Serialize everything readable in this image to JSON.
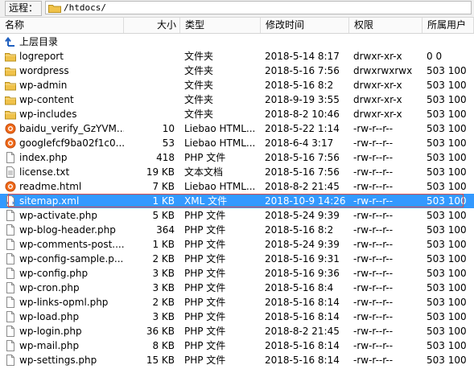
{
  "path_bar": {
    "label": "远程：",
    "path": "/htdocs/"
  },
  "columns": {
    "name": "名称",
    "size": "大小",
    "type": "类型",
    "modified": "修改时间",
    "permissions": "权限",
    "owner": "所属用户"
  },
  "parent_dir": {
    "label": "上层目录"
  },
  "files": [
    {
      "name": "logreport",
      "size": "",
      "type": "文件夹",
      "modified": "2018-5-14 8:17",
      "permissions": "drwxr-xr-x",
      "owner": "0 0",
      "icon": "folder-icon"
    },
    {
      "name": "wordpress",
      "size": "",
      "type": "文件夹",
      "modified": "2018-5-16 7:56",
      "permissions": "drwxrwxrwx",
      "owner": "503 100",
      "icon": "folder-icon"
    },
    {
      "name": "wp-admin",
      "size": "",
      "type": "文件夹",
      "modified": "2018-5-16 8:2",
      "permissions": "drwxr-xr-x",
      "owner": "503 100",
      "icon": "folder-icon"
    },
    {
      "name": "wp-content",
      "size": "",
      "type": "文件夹",
      "modified": "2018-9-19 3:55",
      "permissions": "drwxr-xr-x",
      "owner": "503 100",
      "icon": "folder-icon"
    },
    {
      "name": "wp-includes",
      "size": "",
      "type": "文件夹",
      "modified": "2018-8-2 10:46",
      "permissions": "drwxr-xr-x",
      "owner": "503 100",
      "icon": "folder-icon"
    },
    {
      "name": "baidu_verify_GzYVM...",
      "size": "10",
      "type": "Liebao HTML...",
      "modified": "2018-5-22 1:14",
      "permissions": "-rw-r--r--",
      "owner": "503 100",
      "icon": "browser-html-icon"
    },
    {
      "name": "googlefcf9ba02f1c0...",
      "size": "53",
      "type": "Liebao HTML...",
      "modified": "2018-6-4 3:17",
      "permissions": "-rw-r--r--",
      "owner": "503 100",
      "icon": "browser-html-icon"
    },
    {
      "name": "index.php",
      "size": "418",
      "type": "PHP 文件",
      "modified": "2018-5-16 7:56",
      "permissions": "-rw-r--r--",
      "owner": "503 100",
      "icon": "file-icon"
    },
    {
      "name": "license.txt",
      "size": "19 KB",
      "type": "文本文档",
      "modified": "2018-5-16 7:56",
      "permissions": "-rw-r--r--",
      "owner": "503 100",
      "icon": "text-file-icon"
    },
    {
      "name": "readme.html",
      "size": "7 KB",
      "type": "Liebao HTML...",
      "modified": "2018-8-2 21:45",
      "permissions": "-rw-r--r--",
      "owner": "503 100",
      "icon": "browser-html-icon"
    },
    {
      "name": "sitemap.xml",
      "size": "1 KB",
      "type": "XML 文件",
      "modified": "2018-10-9 14:26",
      "permissions": "-rw-r--r--",
      "owner": "503 100",
      "icon": "xml-file-icon",
      "selected": true
    },
    {
      "name": "wp-activate.php",
      "size": "5 KB",
      "type": "PHP 文件",
      "modified": "2018-5-24 9:39",
      "permissions": "-rw-r--r--",
      "owner": "503 100",
      "icon": "file-icon"
    },
    {
      "name": "wp-blog-header.php",
      "size": "364",
      "type": "PHP 文件",
      "modified": "2018-5-16 8:2",
      "permissions": "-rw-r--r--",
      "owner": "503 100",
      "icon": "file-icon"
    },
    {
      "name": "wp-comments-post....",
      "size": "1 KB",
      "type": "PHP 文件",
      "modified": "2018-5-24 9:39",
      "permissions": "-rw-r--r--",
      "owner": "503 100",
      "icon": "file-icon"
    },
    {
      "name": "wp-config-sample.p...",
      "size": "2 KB",
      "type": "PHP 文件",
      "modified": "2018-5-16 9:31",
      "permissions": "-rw-r--r--",
      "owner": "503 100",
      "icon": "file-icon"
    },
    {
      "name": "wp-config.php",
      "size": "3 KB",
      "type": "PHP 文件",
      "modified": "2018-5-16 9:36",
      "permissions": "-rw-r--r--",
      "owner": "503 100",
      "icon": "file-icon"
    },
    {
      "name": "wp-cron.php",
      "size": "3 KB",
      "type": "PHP 文件",
      "modified": "2018-5-16 8:4",
      "permissions": "-rw-r--r--",
      "owner": "503 100",
      "icon": "file-icon"
    },
    {
      "name": "wp-links-opml.php",
      "size": "2 KB",
      "type": "PHP 文件",
      "modified": "2018-5-16 8:14",
      "permissions": "-rw-r--r--",
      "owner": "503 100",
      "icon": "file-icon"
    },
    {
      "name": "wp-load.php",
      "size": "3 KB",
      "type": "PHP 文件",
      "modified": "2018-5-16 8:14",
      "permissions": "-rw-r--r--",
      "owner": "503 100",
      "icon": "file-icon"
    },
    {
      "name": "wp-login.php",
      "size": "36 KB",
      "type": "PHP 文件",
      "modified": "2018-8-2 21:45",
      "permissions": "-rw-r--r--",
      "owner": "503 100",
      "icon": "file-icon"
    },
    {
      "name": "wp-mail.php",
      "size": "8 KB",
      "type": "PHP 文件",
      "modified": "2018-5-16 8:14",
      "permissions": "-rw-r--r--",
      "owner": "503 100",
      "icon": "file-icon"
    },
    {
      "name": "wp-settings.php",
      "size": "15 KB",
      "type": "PHP 文件",
      "modified": "2018-5-16 8:14",
      "permissions": "-rw-r--r--",
      "owner": "503 100",
      "icon": "file-icon"
    }
  ],
  "colors": {
    "selection": "#3399ff",
    "selection_outline": "#e24a4a",
    "folder": "#f0c24a"
  }
}
